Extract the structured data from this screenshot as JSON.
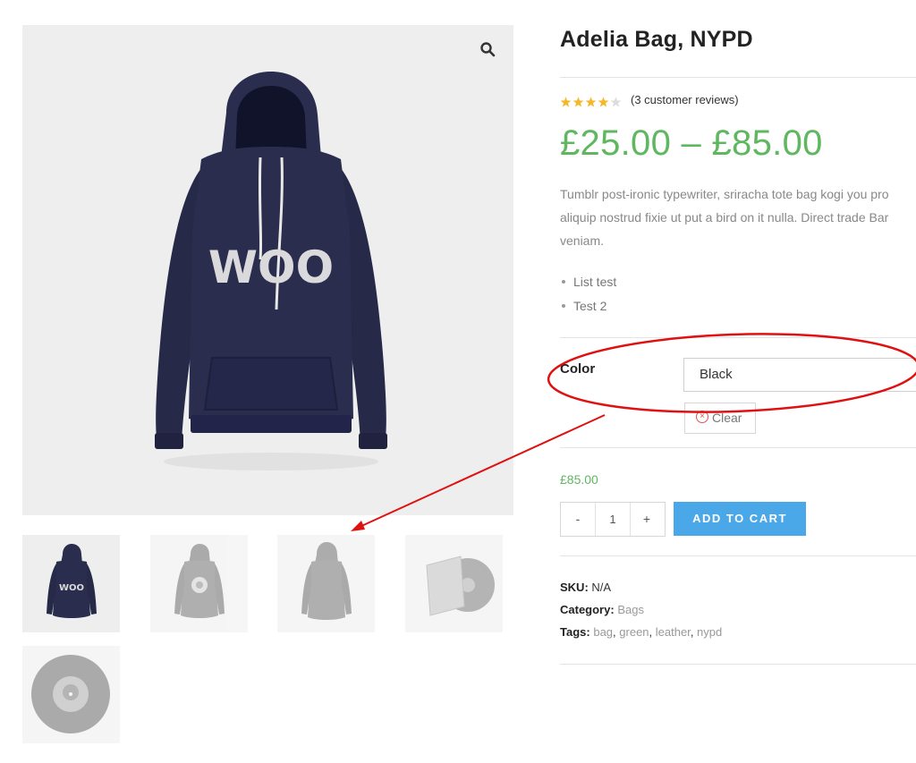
{
  "product": {
    "title": "Adelia Bag, NYPD",
    "rating": 4,
    "rating_max": 5,
    "reviews_link": "(3 customer reviews)",
    "price_range": "£25.00 – £85.00",
    "description_lines": [
      "Tumblr post-ironic typewriter, sriracha tote bag kogi you pro",
      "aliquip nostrud fixie ut put a bird on it nulla. Direct trade Bar",
      "veniam."
    ],
    "bullets": [
      "List test",
      "Test 2"
    ],
    "main_image_print": "WOO",
    "thumb_print": "WOO"
  },
  "variation": {
    "label": "Color",
    "selected": "Black",
    "clear_label": "Clear",
    "price": "£85.00"
  },
  "cart": {
    "minus": "-",
    "quantity": "1",
    "plus": "+",
    "add_to_cart": "ADD TO CART"
  },
  "meta": {
    "sku_label": "SKU:",
    "sku_value": "N/A",
    "category_label": "Category:",
    "category": "Bags",
    "tags_label": "Tags:",
    "tags": [
      "bag",
      "green",
      "leather",
      "nypd"
    ],
    "tag_separator": ", "
  },
  "icons": {
    "zoom": "search-icon",
    "clear": "close-circle-icon",
    "stars": "star-icon"
  },
  "colors": {
    "price_green": "#5fb760",
    "button_blue": "#4aa8e8",
    "annotation_red": "#e01010",
    "hoodie_navy": "#2a2d4d",
    "star_gold": "#f5b82a",
    "star_empty": "#dddddd"
  }
}
